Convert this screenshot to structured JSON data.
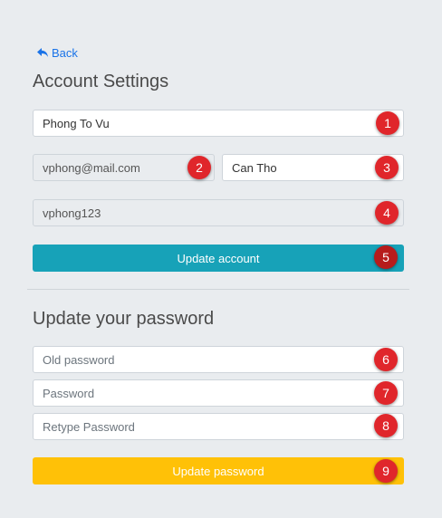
{
  "back_label": "Back",
  "account_section": {
    "title": "Account Settings",
    "full_name_value": "Phong To Vu",
    "email_value": "vphong@mail.com",
    "city_value": "Can Tho",
    "username_value": "vphong123",
    "update_button_label": "Update account"
  },
  "password_section": {
    "title": "Update your password",
    "old_password_placeholder": "Old password",
    "password_placeholder": "Password",
    "retype_placeholder": "Retype Password",
    "update_button_label": "Update password"
  },
  "badges": [
    "1",
    "2",
    "3",
    "4",
    "5",
    "6",
    "7",
    "8",
    "9"
  ],
  "colors": {
    "background": "#e9ecef",
    "link": "#1a73e8",
    "update_account": "#17a2b8",
    "update_password": "#ffc107",
    "badge": "#e0262b"
  },
  "icons": {
    "back": "reply-arrow-icon"
  }
}
